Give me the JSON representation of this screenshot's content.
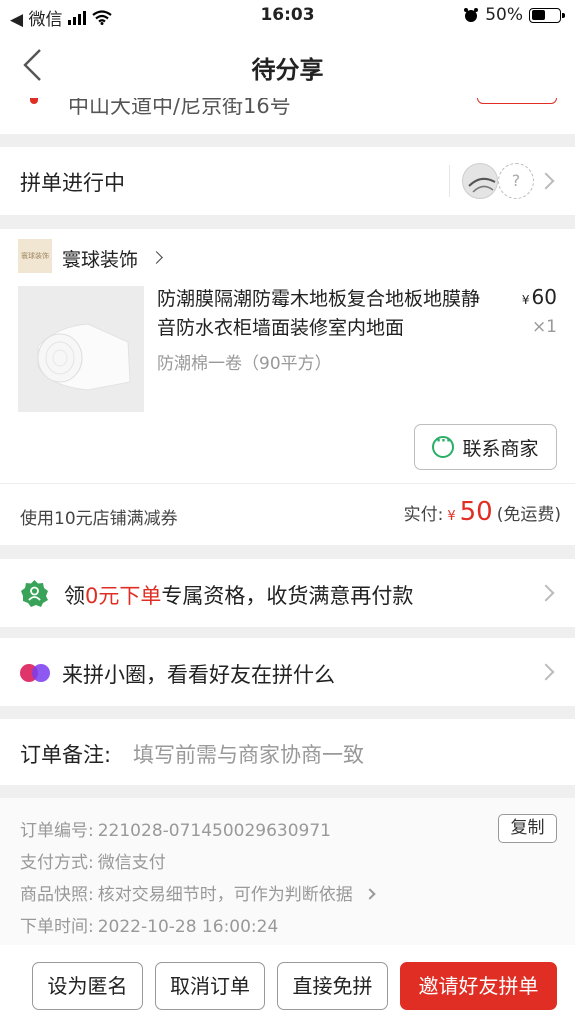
{
  "status_bar": {
    "carrier": "◀ 微信",
    "time": "16:03",
    "battery": "50%"
  },
  "nav": {
    "title": "待分享",
    "back_icon": "chevron-left-icon"
  },
  "address": {
    "partial_text": "中山大道中/尼京街16号"
  },
  "group": {
    "label": "拼单进行中",
    "placeholder_avatar_text": "?"
  },
  "order": {
    "shop_name": "寰球装饰",
    "shop_logo_text": "寰球装饰",
    "product_title": "防潮膜隔潮防霉木地板复合地板地膜静音防水衣柜墙面装修室内地面",
    "product_spec": "防潮棉一卷（90平方）",
    "price_symbol": "¥",
    "price": "60",
    "quantity": "×1",
    "contact_label": "联系商家",
    "coupon_text": "使用10元店铺满减券",
    "paid_label": "实付:",
    "paid_symbol": "¥",
    "paid_amount": "50",
    "paid_note": "(免运费)"
  },
  "zero_pay": {
    "prefix": "领",
    "highlight": "0元下单",
    "suffix": "专属资格，收货满意再付款"
  },
  "circle": {
    "text": "来拼小圈，看看好友在拼什么"
  },
  "note": {
    "label": "订单备注:",
    "placeholder": "填写前需与商家协商一致"
  },
  "info": {
    "order_no_label": "订单编号:",
    "order_no": "221028-071450029630971",
    "copy_label": "复制",
    "payment_label": "支付方式:",
    "payment": "微信支付",
    "snapshot_label": "商品快照:",
    "snapshot": "核对交易细节时，可作为判断依据",
    "time_label": "下单时间:",
    "time": "2022-10-28 16:00:24"
  },
  "actions": {
    "anonymous": "设为匿名",
    "cancel": "取消订单",
    "direct": "直接免拼",
    "invite": "邀请好友拼单"
  },
  "colors": {
    "accent_red": "#e02e24",
    "green": "#2aae67",
    "background": "#efefef"
  }
}
